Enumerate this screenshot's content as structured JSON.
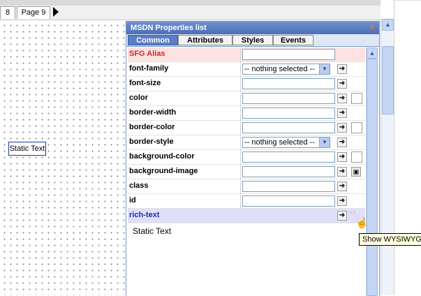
{
  "page_tabs": [
    {
      "label": "8"
    },
    {
      "label": "Page 9"
    }
  ],
  "canvas": {
    "static_text": "Static Text"
  },
  "panel": {
    "title": "MSDN Properties list",
    "close_glyph": "×",
    "tabs": [
      {
        "label": "Common",
        "active": true
      },
      {
        "label": "Attributes",
        "active": false
      },
      {
        "label": "Styles",
        "active": false
      },
      {
        "label": "Events",
        "active": false
      }
    ],
    "properties": [
      {
        "label": "SFG Alias",
        "kind": "text",
        "value": ""
      },
      {
        "label": "font-family",
        "kind": "select",
        "value": "-- nothing selected --"
      },
      {
        "label": "font-size",
        "kind": "text",
        "value": ""
      },
      {
        "label": "color",
        "kind": "color",
        "value": ""
      },
      {
        "label": "border-width",
        "kind": "text",
        "value": ""
      },
      {
        "label": "border-color",
        "kind": "color",
        "value": ""
      },
      {
        "label": "border-style",
        "kind": "select",
        "value": "-- nothing selected --"
      },
      {
        "label": "background-color",
        "kind": "color",
        "value": ""
      },
      {
        "label": "background-image",
        "kind": "image",
        "value": ""
      },
      {
        "label": "class",
        "kind": "text",
        "value": ""
      },
      {
        "label": "id",
        "kind": "text",
        "value": ""
      },
      {
        "label": "rich-text",
        "kind": "rich",
        "value": ""
      }
    ],
    "rich_text_value": "Static Text"
  },
  "tooltip": "Show WYSIWYG",
  "icons": {
    "edit": "edit-arrow-icon",
    "close": "close-icon",
    "scroll_up": "scroll-up-icon",
    "dropdown": "chevron-down-icon",
    "cursor": "hand-cursor-icon"
  },
  "colors": {
    "title_bar": "#4a6fb8",
    "alias_row": "#fde2e2",
    "alias_label": "#e02020",
    "rich_row": "#dfe0f7",
    "rich_label": "#1530b0",
    "tooltip_bg": "#ffffe1"
  }
}
